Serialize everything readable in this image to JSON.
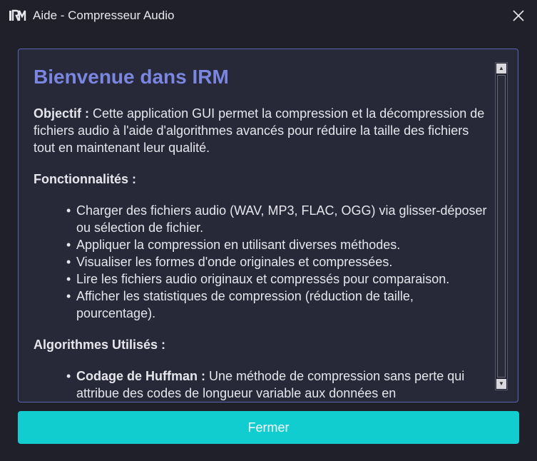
{
  "window": {
    "title": "Aide - Compresseur Audio",
    "logo_icon": "irm-logo-icon",
    "close_icon": "close-icon"
  },
  "help": {
    "heading": "Bienvenue dans IRM",
    "objective_label": "Objectif :",
    "objective_text": " Cette application GUI permet la compression et la décompression de fichiers audio à l'aide d'algorithmes avancés pour réduire la taille des fichiers tout en maintenant leur qualité.",
    "features_title": "Fonctionnalités :",
    "features": [
      "Charger des fichiers audio (WAV, MP3, FLAC, OGG) via glisser-déposer ou sélection de fichier.",
      "Appliquer la compression en utilisant diverses méthodes.",
      "Visualiser les formes d'onde originales et compressées.",
      "Lire les fichiers audio originaux et compressés pour comparaison.",
      "Afficher les statistiques de compression (réduction de taille, pourcentage)."
    ],
    "algorithms_title": "Algorithmes Utilisés :",
    "algorithms": [
      {
        "name": "Codage de Huffman :",
        "description": " Une méthode de compression sans perte qui attribue des codes de longueur variable aux données en"
      }
    ]
  },
  "scrollbar": {
    "up_icon": "scroll-up-arrow-icon",
    "down_icon": "scroll-down-arrow-icon"
  },
  "footer": {
    "close_label": "Fermer"
  },
  "colors": {
    "accent": "#12cdd0",
    "heading": "#7b86e0",
    "frame_border": "#5b64b0",
    "background": "#1f2029"
  }
}
